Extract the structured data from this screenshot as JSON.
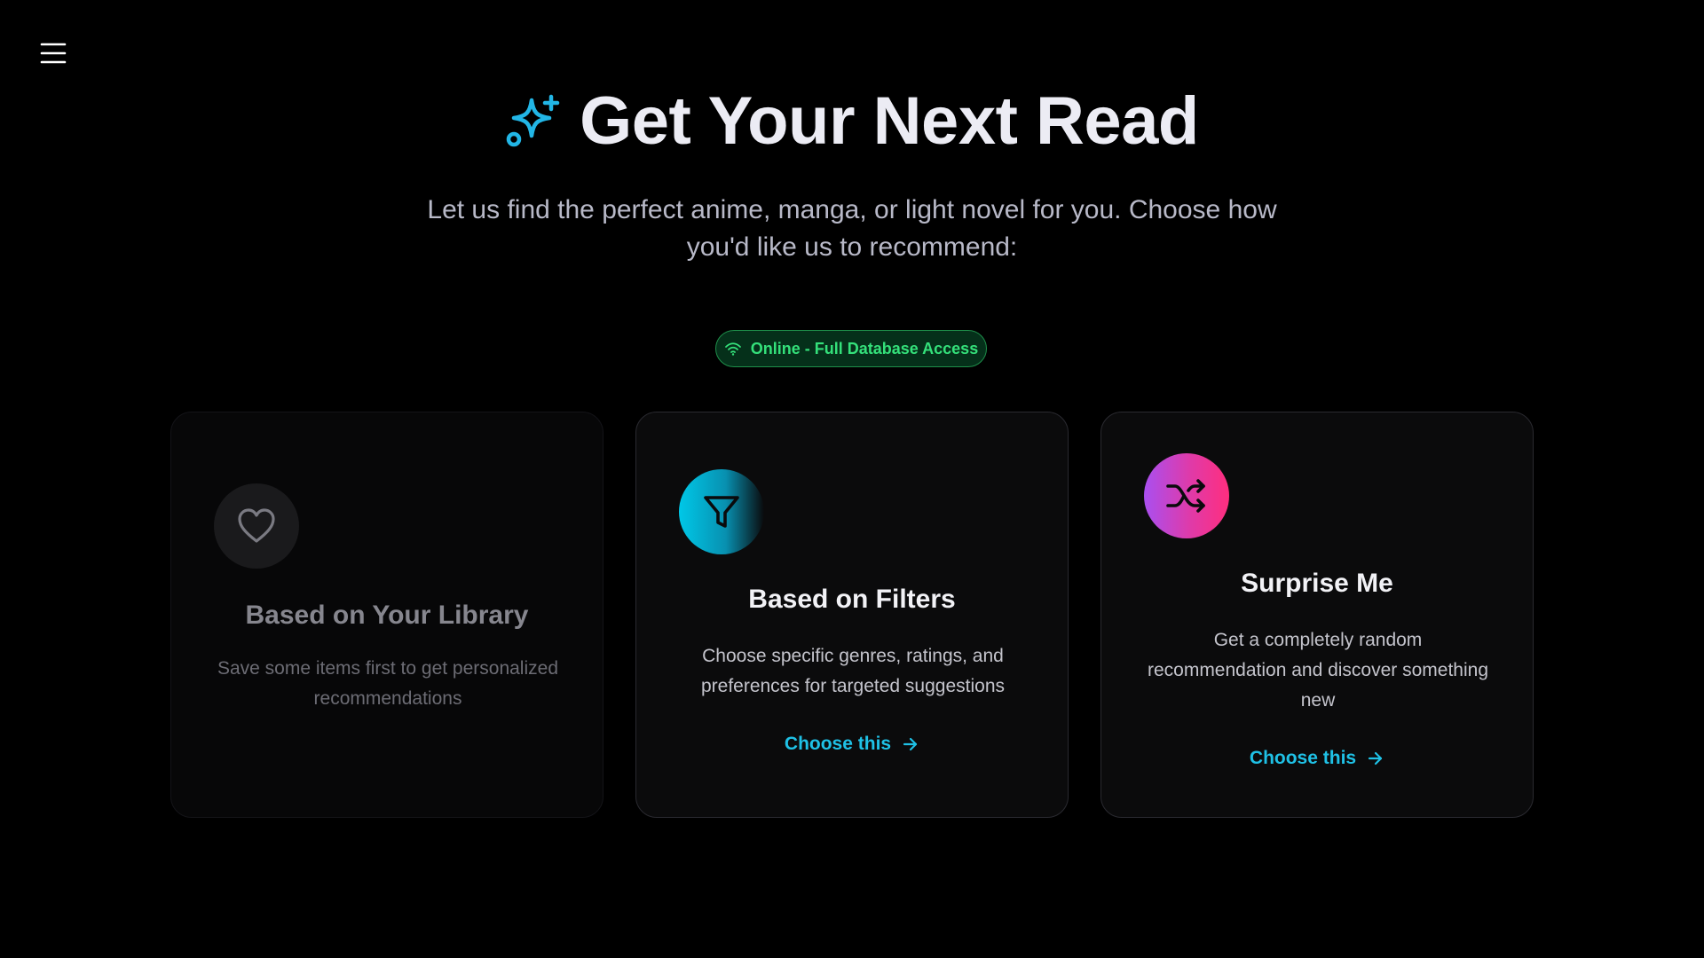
{
  "header": {
    "title": "Get Your Next Read",
    "subtitle": "Let us find the perfect anime, manga, or light novel for you. Choose how you'd like us to recommend:"
  },
  "status": {
    "label": "Online - Full Database Access",
    "icon": "wifi-icon"
  },
  "cards": [
    {
      "title": "Based on Your Library",
      "description": "Save some items first to get personalized recommendations",
      "icon": "heart-icon",
      "disabled": true
    },
    {
      "title": "Based on Filters",
      "description": "Choose specific genres, ratings, and preferences for targeted suggestions",
      "icon": "filter-icon",
      "action": "Choose this"
    },
    {
      "title": "Surprise Me",
      "description": "Get a completely random recommendation and discover something new",
      "icon": "shuffle-icon",
      "action": "Choose this"
    }
  ],
  "colors": {
    "accent": "#1fc1e6",
    "online_green": "#34e07a",
    "background": "#000000",
    "card_bg": "#0b0b0c",
    "filter_gradient": [
      "#00c8e8",
      "#0a0a0c"
    ],
    "shuffle_gradient": [
      "#a94ff0",
      "#ff2e7e"
    ]
  }
}
